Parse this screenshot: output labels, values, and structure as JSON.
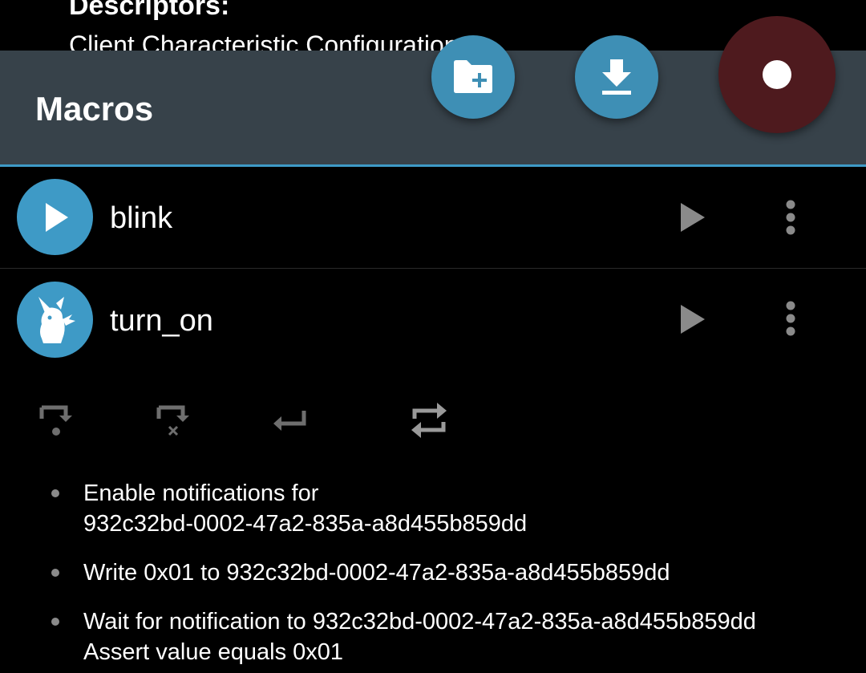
{
  "background": {
    "descriptors_label": "Descriptors:",
    "client_config_text": "Client Characteristic Configuration"
  },
  "header": {
    "title": "Macros",
    "actions": {
      "folder_icon": "create-folder-icon",
      "download_icon": "download-icon",
      "record_icon": "record-icon"
    }
  },
  "colors": {
    "header_bg": "#37424a",
    "accent": "#3e9ac6",
    "record_bg": "#4e1a1e"
  },
  "macros": [
    {
      "name": "blink",
      "icon": "play-icon"
    },
    {
      "name": "turn_on",
      "icon": "pikachu-icon"
    }
  ],
  "toolbar_icons": [
    "wrap-next-icon",
    "wrap-cancel-icon",
    "return-icon",
    "repeat-icon"
  ],
  "operations": [
    {
      "line1": "Enable notifications for",
      "line2": "932c32bd-0002-47a2-835a-a8d455b859dd"
    },
    {
      "line1": "Write 0x01 to 932c32bd-0002-47a2-835a-a8d455b859dd"
    },
    {
      "line1": "Wait for notification to 932c32bd-0002-47a2-835a-a8d455b859dd",
      "line2": "Assert value equals 0x01"
    }
  ]
}
